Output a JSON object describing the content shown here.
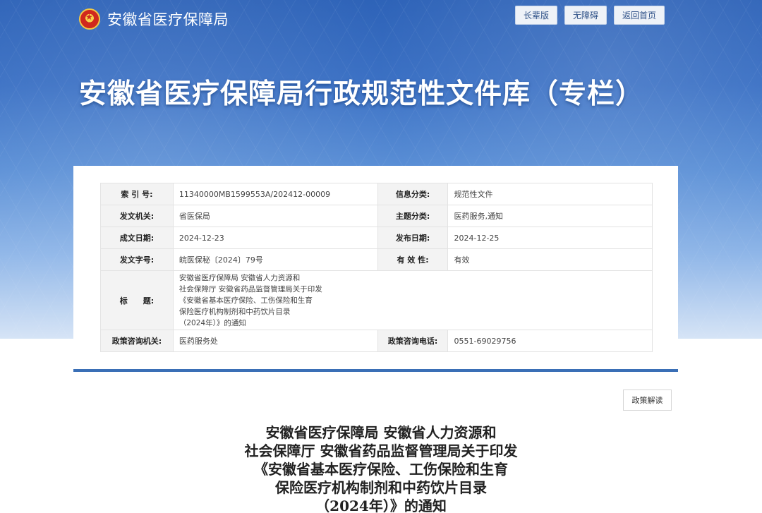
{
  "header": {
    "org_name": "安徽省医疗保障局",
    "buttons": [
      "长辈版",
      "无障碍",
      "返回首页"
    ],
    "banner_title": "安徽省医疗保障局行政规范性文件库（专栏）"
  },
  "meta": {
    "rows": [
      {
        "k1": "索 引 号:",
        "v1": "11340000MB1599553A/202412-00009",
        "k2": "信息分类:",
        "v2": "规范性文件"
      },
      {
        "k1": "发文机关:",
        "v1": "省医保局",
        "k2": "主题分类:",
        "v2": "医药服务,通知"
      },
      {
        "k1": "成文日期:",
        "v1": "2024-12-23",
        "k2": "发布日期:",
        "v2": "2024-12-25"
      },
      {
        "k1": "发文字号:",
        "v1": "皖医保秘〔2024〕79号",
        "k2": "有 效 性:",
        "v2": "有效"
      }
    ],
    "title_label": "标　　题:",
    "title_lines": [
      "安徽省医疗保障局 安徽省人力资源和",
      "社会保障厅 安徽省药品监督管理局关于印发",
      "《安徽省基本医疗保险、工伤保险和生育",
      "保险医疗机构制剂和中药饮片目录",
      "（2024年）》的通知"
    ],
    "last_row": {
      "k1": "政策咨询机关:",
      "v1": "医药服务处",
      "k2": "政策咨询电话:",
      "v2": "0551-69029756"
    }
  },
  "policy_button": "政策解读",
  "doc_title_lines": [
    "安徽省医疗保障局 安徽省人力资源和",
    "社会保障厅 安徽省药品监督管理局关于印发",
    "《安徽省基本医疗保险、工伤保险和生育",
    "保险医疗机构制剂和中药饮片目录",
    "（2024年）》的通知"
  ],
  "colors": {
    "banner_top": "#2e63b8",
    "accent_line": "#3a6fb6"
  }
}
